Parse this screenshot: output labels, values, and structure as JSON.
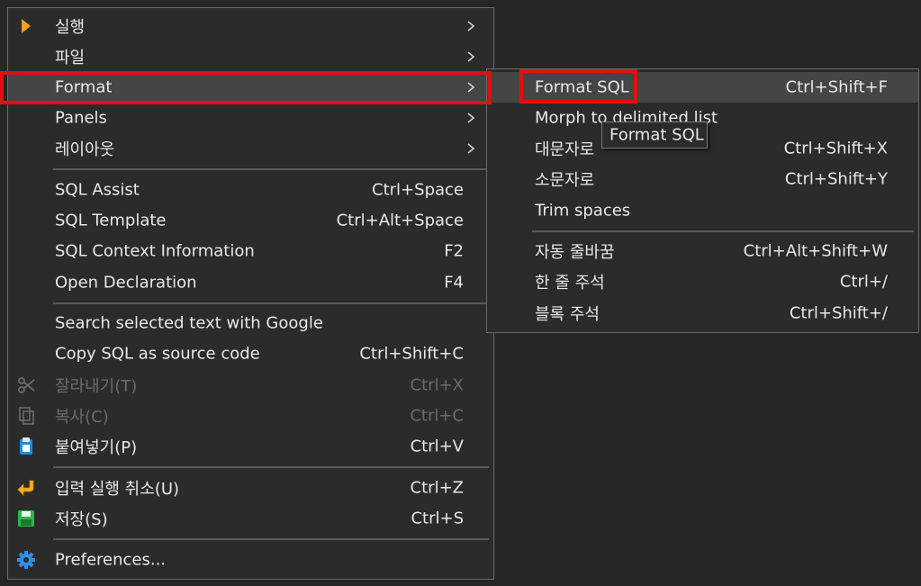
{
  "main_menu": {
    "run": {
      "label": "실행"
    },
    "file": {
      "label": "파일"
    },
    "format": {
      "label": "Format"
    },
    "panels": {
      "label": "Panels"
    },
    "layout": {
      "label": "레이아웃"
    },
    "sql_assist": {
      "label": "SQL Assist",
      "shortcut": "Ctrl+Space"
    },
    "sql_template": {
      "label": "SQL Template",
      "shortcut": "Ctrl+Alt+Space"
    },
    "sql_context": {
      "label": "SQL Context Information",
      "shortcut": "F2"
    },
    "open_declaration": {
      "label": "Open Declaration",
      "shortcut": "F4"
    },
    "search_google": {
      "label": "Search selected text with Google"
    },
    "copy_sql_source": {
      "label": "Copy SQL as source code",
      "shortcut": "Ctrl+Shift+C"
    },
    "cut": {
      "label": "잘라내기(T)",
      "shortcut": "Ctrl+X"
    },
    "copy": {
      "label": "복사(C)",
      "shortcut": "Ctrl+C"
    },
    "paste": {
      "label": "붙여넣기(P)",
      "shortcut": "Ctrl+V"
    },
    "undo": {
      "label": "입력 실행 취소(U)",
      "shortcut": "Ctrl+Z"
    },
    "save": {
      "label": "저장(S)",
      "shortcut": "Ctrl+S"
    },
    "preferences": {
      "label": "Preferences..."
    }
  },
  "format_submenu": {
    "format_sql": {
      "label": "Format SQL",
      "shortcut": "Ctrl+Shift+F"
    },
    "morph": {
      "label": "Morph to delimited list"
    },
    "uppercase": {
      "label": "대문자로",
      "shortcut": "Ctrl+Shift+X"
    },
    "lowercase": {
      "label": "소문자로",
      "shortcut": "Ctrl+Shift+Y"
    },
    "trim_spaces": {
      "label": "Trim spaces"
    },
    "auto_wrap": {
      "label": "자동 줄바꿈",
      "shortcut": "Ctrl+Alt+Shift+W"
    },
    "line_comment": {
      "label": "한 줄 주석",
      "shortcut": "Ctrl+/"
    },
    "block_comment": {
      "label": "블록 주석",
      "shortcut": "Ctrl+Shift+/"
    }
  },
  "tooltip": {
    "text": "Format SQL"
  },
  "colors": {
    "menu_bg": "#2b2b2b",
    "hover_bg": "#454545",
    "highlight_border": "#e01010",
    "text": "#e8e8e8",
    "disabled_text": "#6b6b6b"
  },
  "icons": {
    "run": "play-triangle-orange",
    "cut": "scissors",
    "copy": "copy-pages",
    "paste": "clipboard-blue",
    "undo": "undo-arrow-yellow",
    "save": "floppy-disk-green",
    "preferences": "gear-blue",
    "submenu": "chevron-right"
  }
}
